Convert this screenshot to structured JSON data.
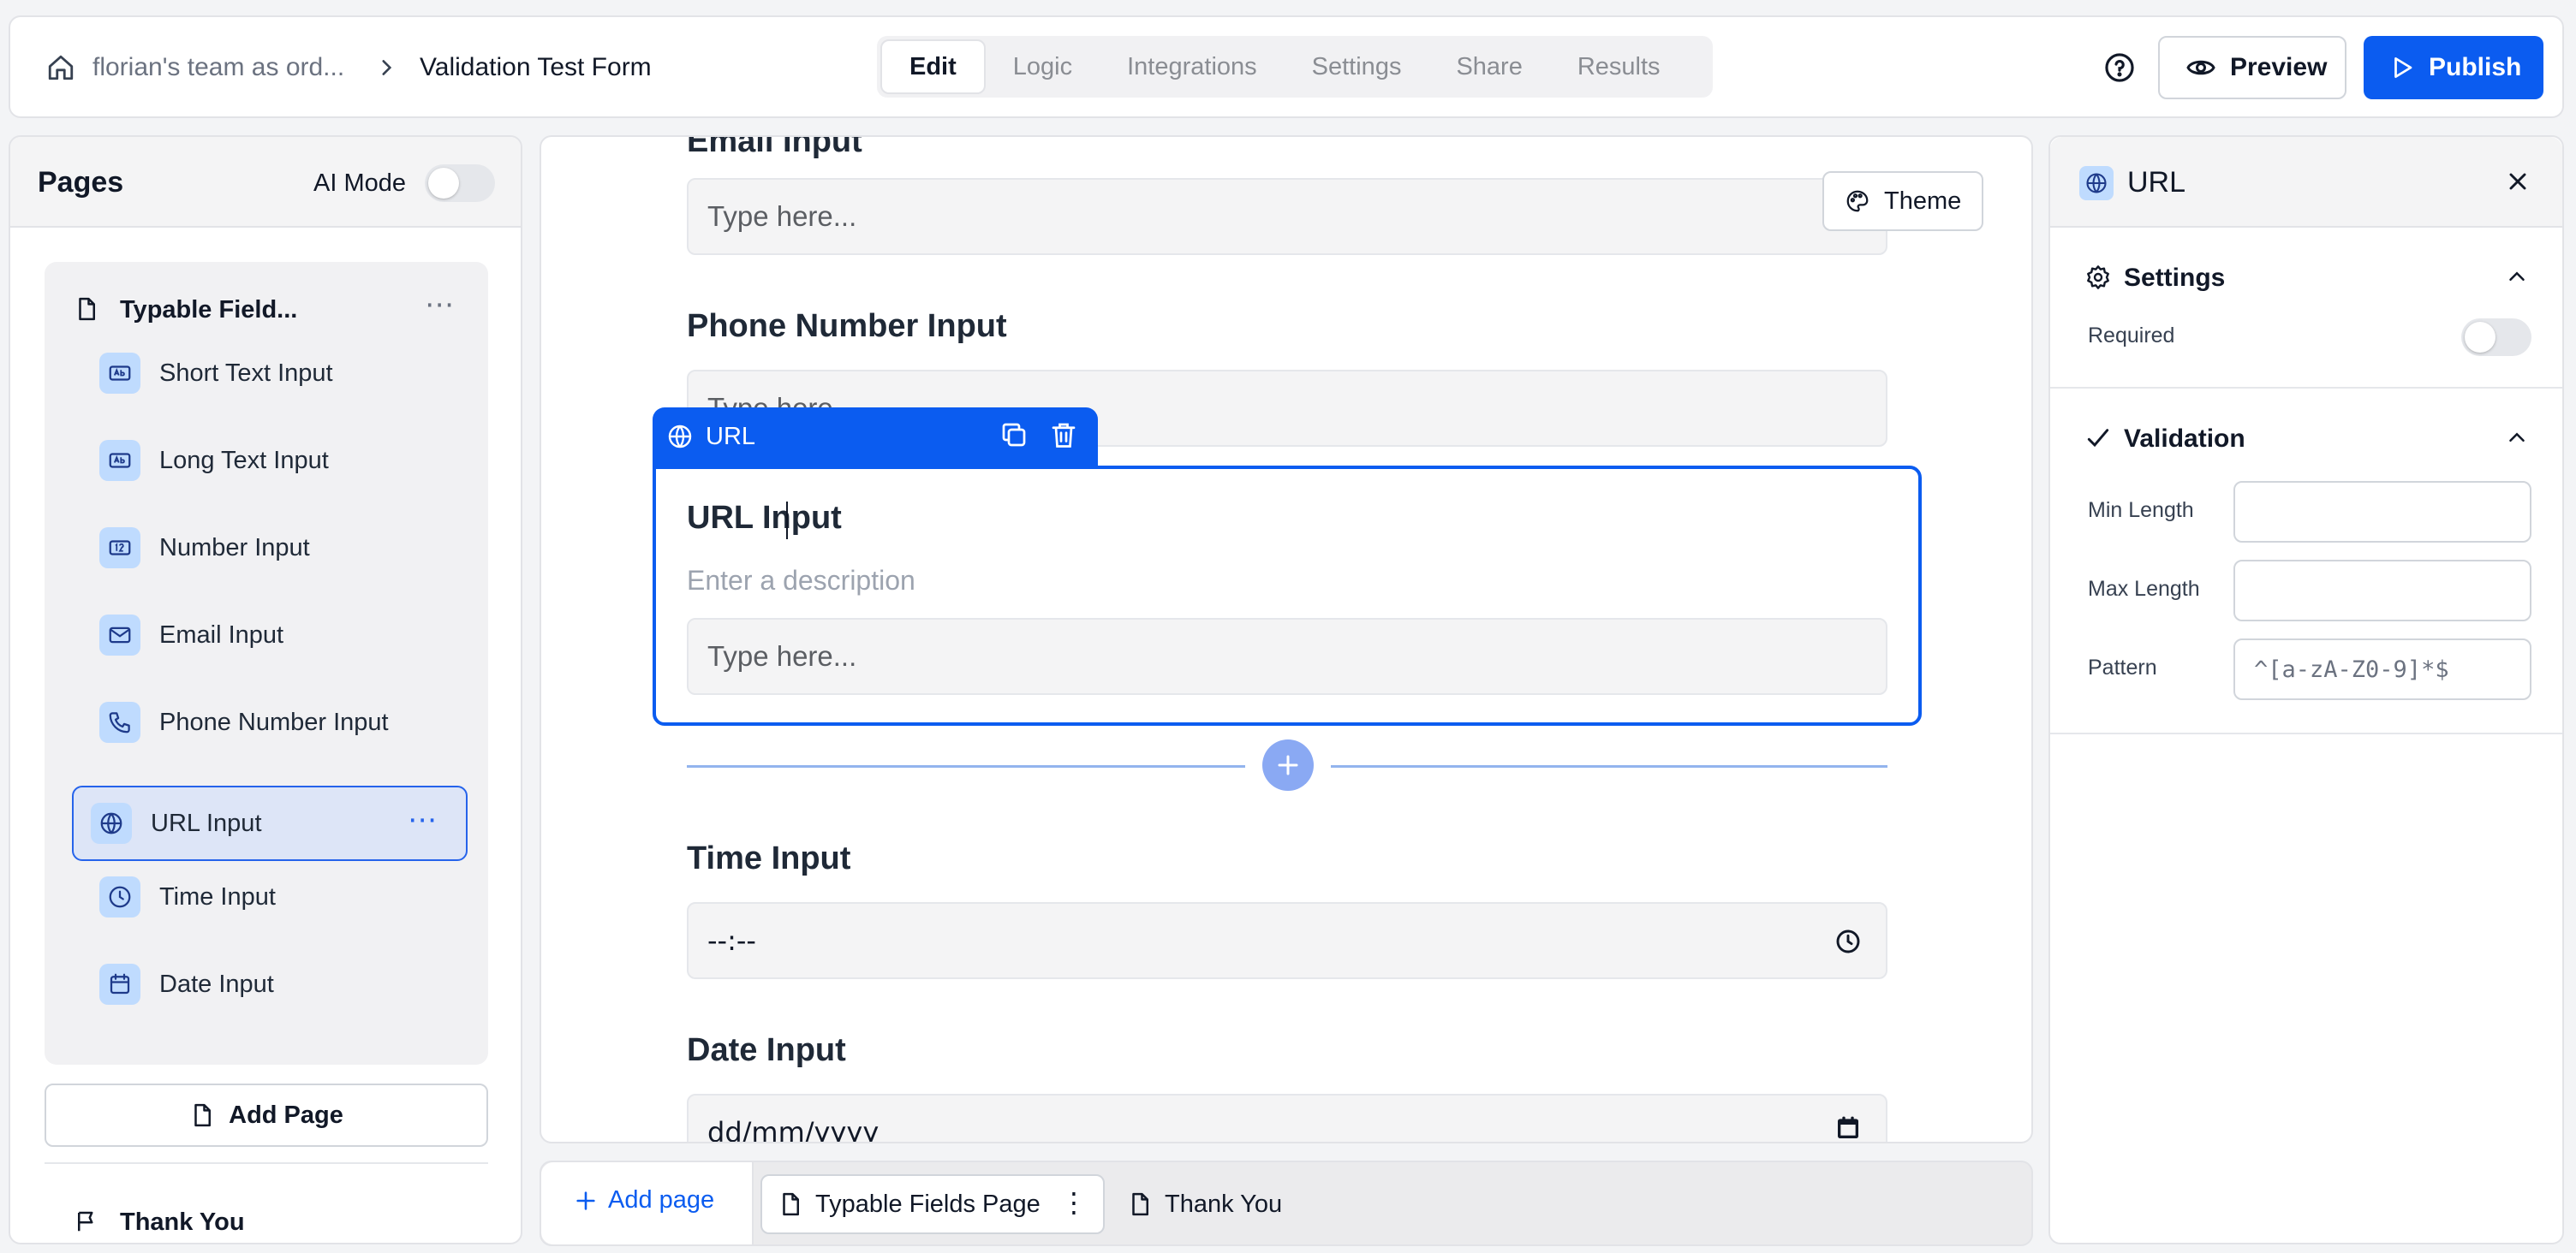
{
  "topbar": {
    "workspace": "florian's team as ord...",
    "form_title": "Validation Test Form",
    "tabs": [
      "Edit",
      "Logic",
      "Integrations",
      "Settings",
      "Share",
      "Results"
    ],
    "active_tab": "Edit",
    "preview_label": "Preview",
    "publish_label": "Publish"
  },
  "left_panel": {
    "title": "Pages",
    "ai_mode_label": "AI Mode",
    "ai_mode_on": false,
    "page_title": "Typable Field...",
    "items": [
      {
        "label": "Short Text Input",
        "icon": "text-icon"
      },
      {
        "label": "Long Text Input",
        "icon": "text-icon"
      },
      {
        "label": "Number Input",
        "icon": "number-icon"
      },
      {
        "label": "Email Input",
        "icon": "mail-icon"
      },
      {
        "label": "Phone Number Input",
        "icon": "phone-icon"
      },
      {
        "label": "URL Input",
        "icon": "globe-icon"
      },
      {
        "label": "Time Input",
        "icon": "clock-icon"
      },
      {
        "label": "Date Input",
        "icon": "calendar-icon"
      }
    ],
    "selected_item": "URL Input",
    "add_page_label": "Add Page",
    "thank_you_label": "Thank You"
  },
  "canvas": {
    "theme_label": "Theme",
    "email_label": "Email Input",
    "email_placeholder": "Type here...",
    "phone_label": "Phone Number Input",
    "phone_placeholder": "Type here",
    "url_tag": "URL",
    "url_label": "URL Input",
    "url_description_placeholder": "Enter a description",
    "url_placeholder": "Type here...",
    "time_label": "Time Input",
    "time_value": "--:--",
    "date_label": "Date Input",
    "date_value": "dd/mm/yyyy"
  },
  "bottom_bar": {
    "add_page_label": "Add page",
    "pages": [
      "Typable Fields Page",
      "Thank You"
    ],
    "active_page": "Typable Fields Page"
  },
  "right_panel": {
    "title": "URL",
    "settings_title": "Settings",
    "required_label": "Required",
    "required_on": false,
    "validation_title": "Validation",
    "min_length_label": "Min Length",
    "min_length_value": "",
    "max_length_label": "Max Length",
    "max_length_value": "",
    "pattern_label": "Pattern",
    "pattern_value": "^[a-zA-Z0-9]*$"
  },
  "colors": {
    "accent": "#0b5cf0",
    "selected_bg": "#dde5f7",
    "icon_bg": "#bfdbfe"
  }
}
